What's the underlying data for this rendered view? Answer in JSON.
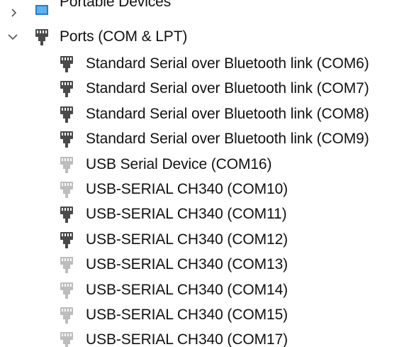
{
  "tree": {
    "portable_devices": {
      "label": "Portable Devices",
      "expanded": false,
      "icon": "portable-device-icon"
    },
    "ports": {
      "label": "Ports (COM & LPT)",
      "expanded": true,
      "icon": "port-connector-icon",
      "children": [
        {
          "label": "Standard Serial over Bluetooth link (COM6)",
          "state": "active",
          "icon": "port-connector-icon"
        },
        {
          "label": "Standard Serial over Bluetooth link (COM7)",
          "state": "active",
          "icon": "port-connector-icon"
        },
        {
          "label": "Standard Serial over Bluetooth link (COM8)",
          "state": "active",
          "icon": "port-connector-icon"
        },
        {
          "label": "Standard Serial over Bluetooth link (COM9)",
          "state": "active",
          "icon": "port-connector-icon"
        },
        {
          "label": "USB Serial Device (COM16)",
          "state": "hidden",
          "icon": "port-connector-icon"
        },
        {
          "label": "USB-SERIAL CH340 (COM10)",
          "state": "hidden",
          "icon": "port-connector-icon"
        },
        {
          "label": "USB-SERIAL CH340 (COM11)",
          "state": "active",
          "icon": "port-connector-icon"
        },
        {
          "label": "USB-SERIAL CH340 (COM12)",
          "state": "active",
          "icon": "port-connector-icon"
        },
        {
          "label": "USB-SERIAL CH340 (COM13)",
          "state": "hidden",
          "icon": "port-connector-icon"
        },
        {
          "label": "USB-SERIAL CH340 (COM14)",
          "state": "hidden",
          "icon": "port-connector-icon"
        },
        {
          "label": "USB-SERIAL CH340 (COM15)",
          "state": "hidden",
          "icon": "port-connector-icon"
        },
        {
          "label": "USB-SERIAL CH340 (COM17)",
          "state": "hidden",
          "icon": "port-connector-icon"
        }
      ]
    }
  },
  "colors": {
    "icon_active": "#4a4a4a",
    "icon_hidden": "#bdbdbd",
    "chevron": "#555555",
    "portable_blue": "#1e7fd8"
  }
}
